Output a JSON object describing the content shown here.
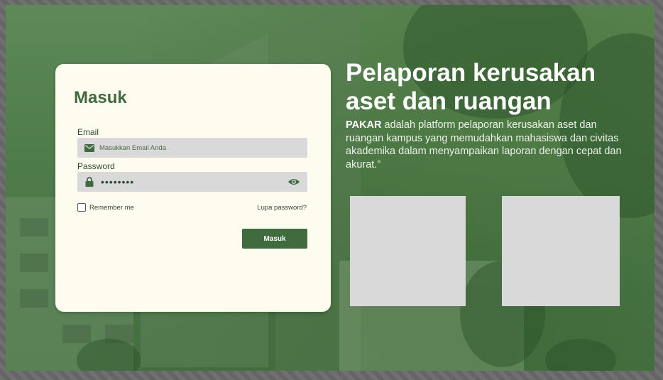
{
  "login": {
    "title": "Masuk",
    "email_label": "Email",
    "email_placeholder": "Masukkan Email Anda",
    "password_label": "Password",
    "password_value": "••••••••",
    "remember_label": "Remember me",
    "forgot_label": "Lupa password?",
    "submit_label": "Masuk"
  },
  "hero": {
    "headline": "Pelaporan kerusakan aset dan ruangan",
    "brand": "PAKAR",
    "description": " adalah platform pelaporan kerusakan aset dan ruangan kampus yang memudahkan mahasiswa dan civitas akademika dalam menyampaikan laporan dengan cepat dan akurat.”"
  },
  "colors": {
    "primary": "#3f6b3e",
    "card_bg": "#fefcef",
    "field_bg": "#d9d9d9",
    "overlay": "#4f7d4a"
  },
  "icons": {
    "email": "mail-icon",
    "password": "lock-icon",
    "toggle": "eye-icon"
  }
}
